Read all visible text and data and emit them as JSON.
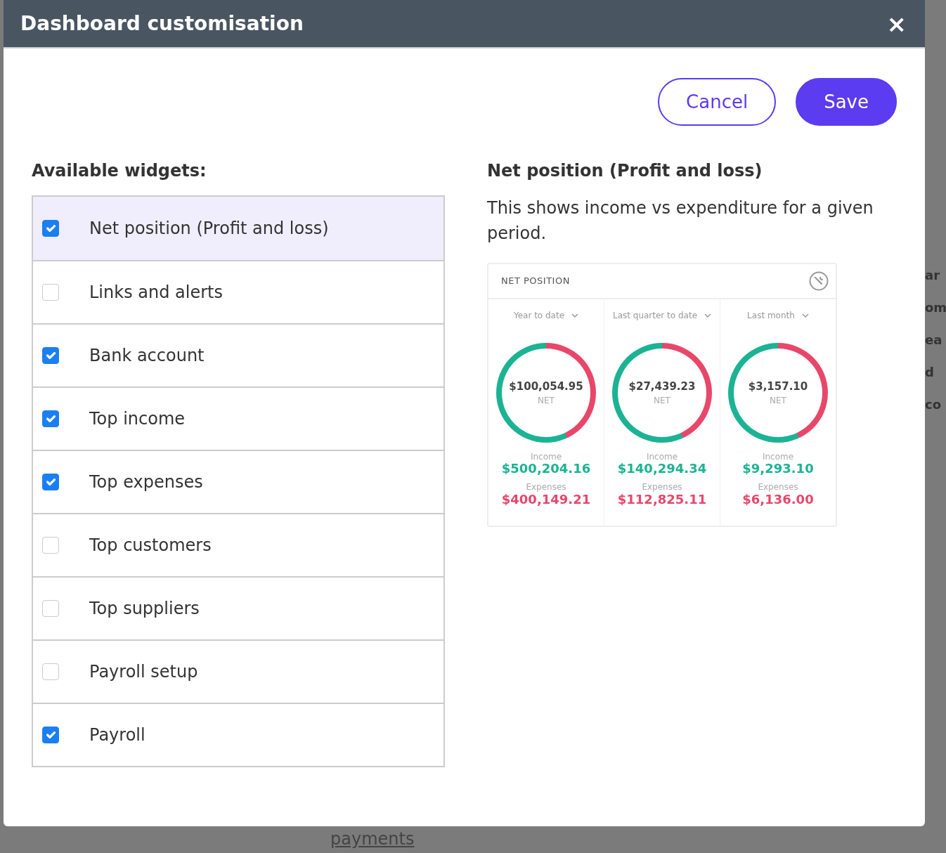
{
  "dialog": {
    "title": "Dashboard customisation",
    "close": "×",
    "buttons": [
      {
        "label": "Cancel",
        "kind": "secondary"
      },
      {
        "label": "Save",
        "kind": "primary"
      }
    ]
  },
  "widgets": {
    "heading": "Available widgets:",
    "items": [
      {
        "label": "Net position (Profit and loss)",
        "checked": true,
        "selected": true
      },
      {
        "label": "Links and alerts",
        "checked": false,
        "selected": false
      },
      {
        "label": "Bank account",
        "checked": true,
        "selected": false
      },
      {
        "label": "Top income",
        "checked": true,
        "selected": false
      },
      {
        "label": "Top expenses",
        "checked": true,
        "selected": false
      },
      {
        "label": "Top customers",
        "checked": false,
        "selected": false
      },
      {
        "label": "Top suppliers",
        "checked": false,
        "selected": false
      },
      {
        "label": "Payroll setup",
        "checked": false,
        "selected": false
      },
      {
        "label": "Payroll",
        "checked": true,
        "selected": false
      }
    ]
  },
  "preview": {
    "heading": "Net position (Profit and loss)",
    "description": "This shows income vs expenditure for a given period.",
    "card": {
      "title": "NET POSITION",
      "columns": [
        {
          "period": "Year to date",
          "net": "$100,054.95",
          "net_label": "NET",
          "income_label": "Income",
          "income": "$500,204.16",
          "expenses_label": "Expenses",
          "expenses": "$400,149.21"
        },
        {
          "period": "Last quarter to date",
          "net": "$27,439.23",
          "net_label": "NET",
          "income_label": "Income",
          "income": "$140,294.34",
          "expenses_label": "Expenses",
          "expenses": "$112,825.11"
        },
        {
          "period": "Last month",
          "net": "$3,157.10",
          "net_label": "NET",
          "income_label": "Income",
          "income": "$9,293.10",
          "expenses_label": "Expenses",
          "expenses": "$6,136.00"
        }
      ]
    }
  },
  "background": {
    "fragments": [
      "ar",
      "om",
      "ea",
      "d",
      "co"
    ],
    "link": "payments"
  }
}
